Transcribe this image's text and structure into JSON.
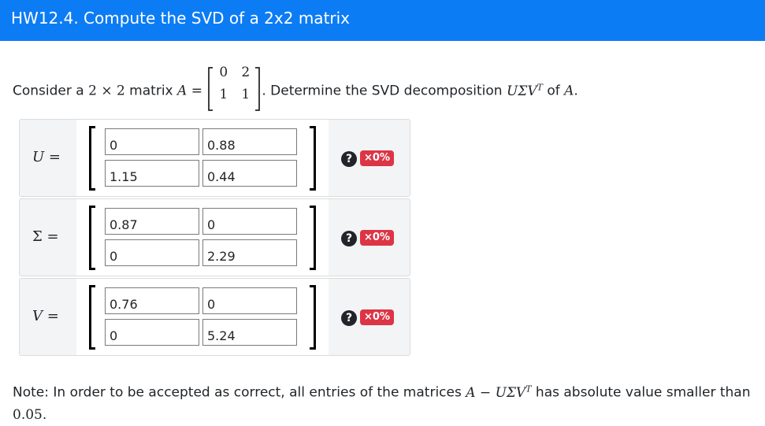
{
  "header": {
    "title": "HW12.4. Compute the SVD of a 2x2 matrix"
  },
  "prompt": {
    "text_before": "Consider a ",
    "dims": "2 × 2",
    "text_matrix": " matrix ",
    "matrix_name": "A",
    "equals": " = ",
    "matrix_A": [
      [
        "0",
        "2"
      ],
      [
        "1",
        "1"
      ]
    ],
    "text_after": ". Determine the SVD decomposition ",
    "svd": "UΣV",
    "svd_sup": "T",
    "text_of": " of ",
    "matrix_name_end": "A",
    "period": "."
  },
  "rows": [
    {
      "label": "U =",
      "cells": [
        "0",
        "0.88",
        "1.15",
        "0.44"
      ],
      "badge": "×0%"
    },
    {
      "label": "Σ =",
      "cells": [
        "0.87",
        "0",
        "0",
        "2.29"
      ],
      "badge": "×0%"
    },
    {
      "label": "V =",
      "cells": [
        "0.76",
        "0",
        "0",
        "5.24"
      ],
      "badge": "×0%"
    }
  ],
  "help_icon": "?",
  "note": {
    "text1": "Note: In order to be accepted as correct, all entries of the matrices ",
    "expr": "A − UΣV",
    "expr_sup": "T",
    "text2": " has absolute value smaller than ",
    "value": "0.05",
    "period": "."
  },
  "colors": {
    "header_bg": "#0c7cf5",
    "badge_bg": "#dc3545",
    "panel_bg": "#f3f4f5"
  }
}
